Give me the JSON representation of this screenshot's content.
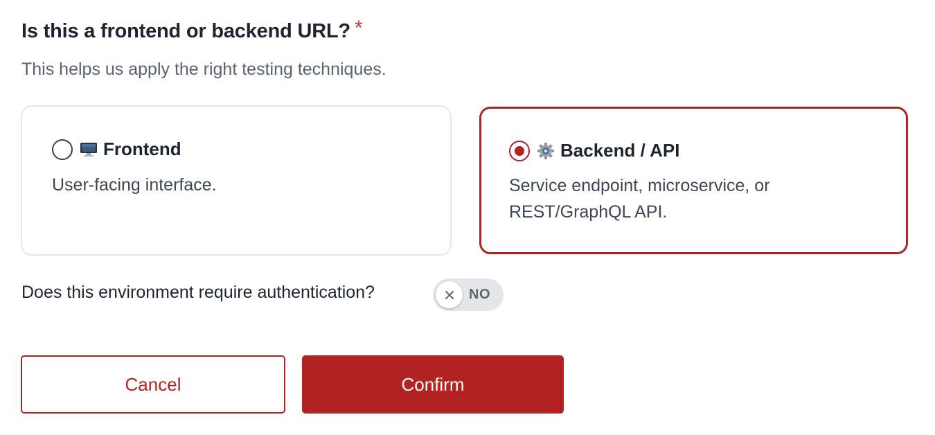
{
  "question": {
    "title": "Is this a frontend or backend URL?",
    "required_mark": "*"
  },
  "helper_text": "This helps us apply the right testing techniques.",
  "options": [
    {
      "title": "Frontend",
      "icon": "desktop-computer-icon",
      "description": "User-facing interface.",
      "selected": false
    },
    {
      "title": "Backend / API",
      "icon": "gear-icon",
      "description": "Service endpoint, microservice, or REST/GraphQL API.",
      "selected": true
    }
  ],
  "auth": {
    "label": "Does this environment require authentication?",
    "toggle_text": "NO",
    "toggle_icon": "close-icon",
    "enabled": false
  },
  "actions": {
    "cancel_label": "Cancel",
    "confirm_label": "Confirm"
  },
  "colors": {
    "accent": "#b22222",
    "required": "#c0392b",
    "toggle_bg": "#e4e6ea"
  }
}
